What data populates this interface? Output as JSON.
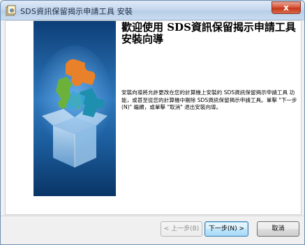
{
  "window": {
    "title": "SDS資訊保留揭示申請工具 安裝",
    "close_glyph": "x"
  },
  "welcome": {
    "title": "歡迎使用 SDS資訊保留揭示申請工具 安裝向導",
    "body": "安裝向導將允許更改在您的計算機上安裝的 SDS資訊保留揭示申請工具 功能，或甚至從您的計算機中刪除 SDS資訊保留揭示申請工具。單擊 \"下一步(N)\" 繼續，或單擊 \"取消\" 退出安裝向導。"
  },
  "buttons": {
    "back": "< 上一步(B)",
    "next": "下一步(N) >",
    "cancel": "取消"
  },
  "colors": {
    "banner_dark": "#0b3a6f",
    "banner_light": "#3b86c9",
    "puzzle_orange": "#e9812a",
    "puzzle_green": "#6cb23a",
    "puzzle_teal": "#1f8fb0"
  }
}
